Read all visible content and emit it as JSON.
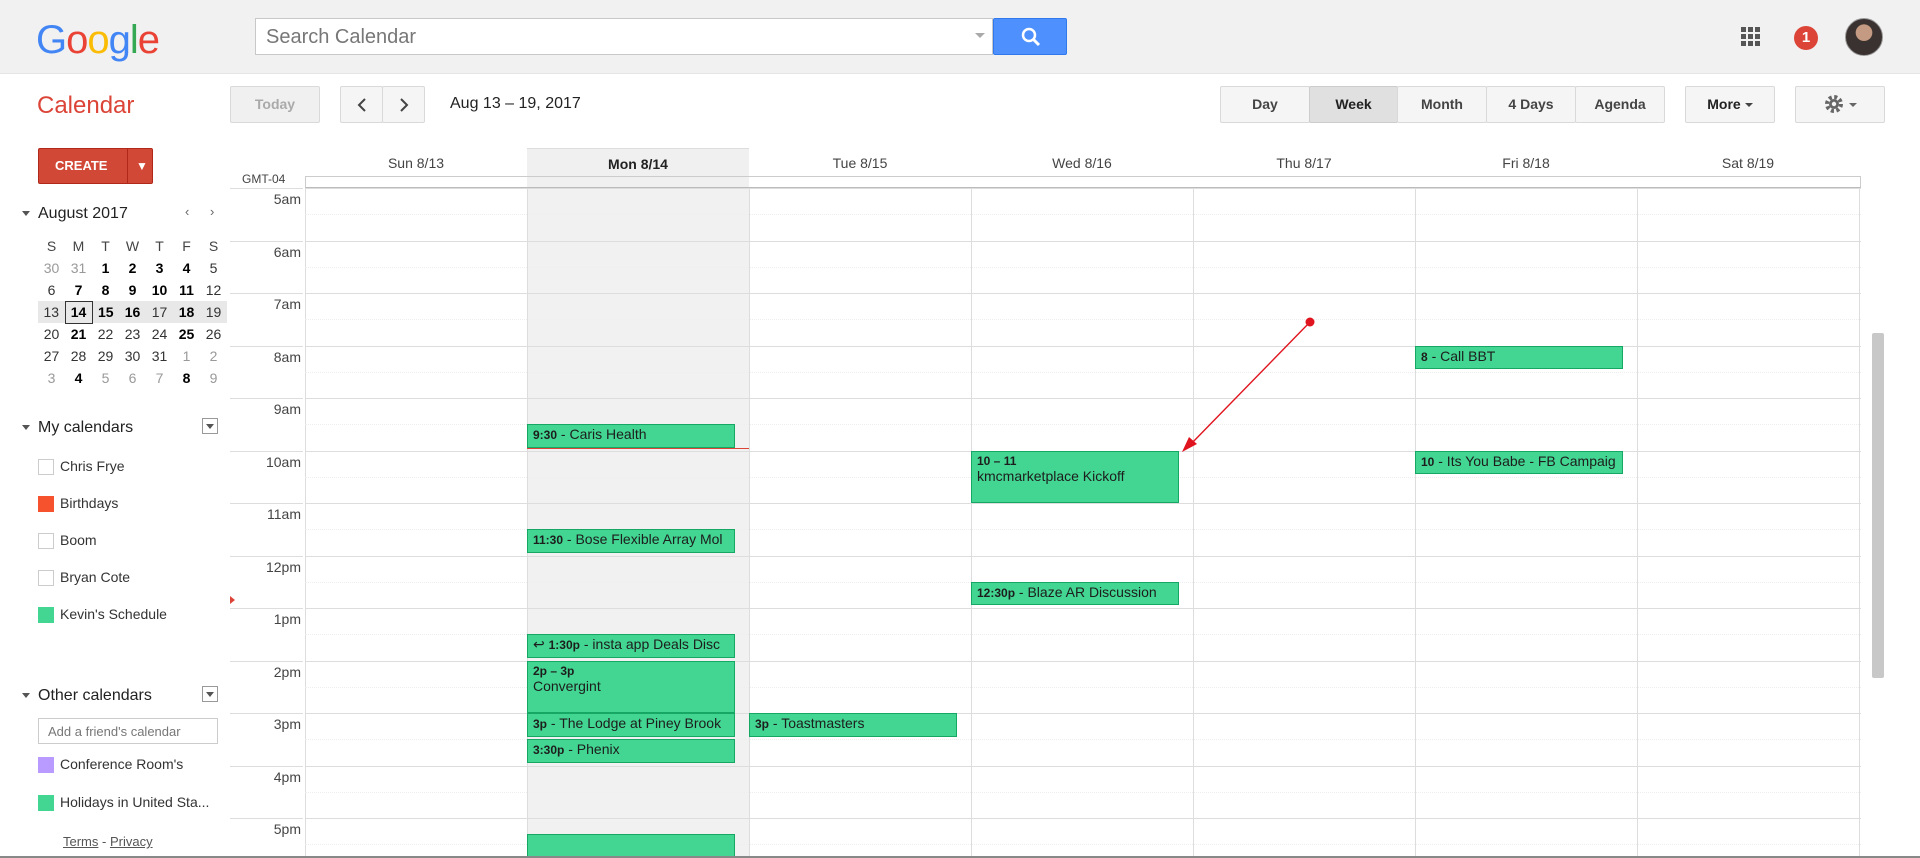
{
  "topbar": {
    "logo": [
      "G",
      "o",
      "o",
      "g",
      "l",
      "e"
    ],
    "search_placeholder": "Search Calendar",
    "notifications": "1"
  },
  "header": {
    "title": "Calendar",
    "today": "Today",
    "date_range": "Aug 13 – 19, 2017",
    "views": {
      "day": "Day",
      "week": "Week",
      "month": "Month",
      "four_days": "4 Days",
      "agenda": "Agenda"
    },
    "more": "More"
  },
  "sidebar": {
    "create": "CREATE",
    "mini_month": "August 2017",
    "weekdays": [
      "S",
      "M",
      "T",
      "W",
      "T",
      "F",
      "S"
    ],
    "weeks": [
      [
        {
          "d": "30",
          "c": "om"
        },
        {
          "d": "31",
          "c": "om"
        },
        {
          "d": "1",
          "c": "b"
        },
        {
          "d": "2",
          "c": "b"
        },
        {
          "d": "3",
          "c": "b"
        },
        {
          "d": "4",
          "c": "b"
        },
        {
          "d": "5",
          "c": ""
        }
      ],
      [
        {
          "d": "6",
          "c": ""
        },
        {
          "d": "7",
          "c": "b"
        },
        {
          "d": "8",
          "c": "b"
        },
        {
          "d": "9",
          "c": "b"
        },
        {
          "d": "10",
          "c": "b"
        },
        {
          "d": "11",
          "c": "b"
        },
        {
          "d": "12",
          "c": ""
        }
      ],
      [
        {
          "d": "13",
          "c": ""
        },
        {
          "d": "14",
          "c": "b today"
        },
        {
          "d": "15",
          "c": "b"
        },
        {
          "d": "16",
          "c": "b"
        },
        {
          "d": "17",
          "c": ""
        },
        {
          "d": "18",
          "c": "b"
        },
        {
          "d": "19",
          "c": ""
        }
      ],
      [
        {
          "d": "20",
          "c": ""
        },
        {
          "d": "21",
          "c": "b"
        },
        {
          "d": "22",
          "c": ""
        },
        {
          "d": "23",
          "c": ""
        },
        {
          "d": "24",
          "c": ""
        },
        {
          "d": "25",
          "c": "b"
        },
        {
          "d": "26",
          "c": ""
        }
      ],
      [
        {
          "d": "27",
          "c": ""
        },
        {
          "d": "28",
          "c": ""
        },
        {
          "d": "29",
          "c": ""
        },
        {
          "d": "30",
          "c": ""
        },
        {
          "d": "31",
          "c": ""
        },
        {
          "d": "1",
          "c": "om"
        },
        {
          "d": "2",
          "c": "om"
        }
      ],
      [
        {
          "d": "3",
          "c": "om"
        },
        {
          "d": "4",
          "c": "om b"
        },
        {
          "d": "5",
          "c": "om"
        },
        {
          "d": "6",
          "c": "om"
        },
        {
          "d": "7",
          "c": "om"
        },
        {
          "d": "8",
          "c": "om b"
        },
        {
          "d": "9",
          "c": "om"
        }
      ]
    ],
    "my_calendars": "My calendars",
    "my_items": [
      {
        "label": "Chris Frye",
        "color": "#ffffff"
      },
      {
        "label": "Birthdays",
        "color": "#f6522e"
      },
      {
        "label": "Boom",
        "color": "#ffffff"
      },
      {
        "label": "Bryan Cote",
        "color": "#ffffff"
      },
      {
        "label": "Kevin's Schedule",
        "color": "#42d692"
      }
    ],
    "other_calendars": "Other calendars",
    "friend_placeholder": "Add a friend's calendar",
    "other_items": [
      {
        "label": "Conference Room's",
        "color": "#b99aff"
      },
      {
        "label": "Holidays in United Sta...",
        "color": "#42d692"
      }
    ],
    "terms": "Terms",
    "privacy": "Privacy",
    "sep": " - "
  },
  "grid": {
    "timezone": "GMT-04",
    "days": [
      "Sun 8/13",
      "Mon 8/14",
      "Tue 8/15",
      "Wed 8/16",
      "Thu 8/17",
      "Fri 8/18",
      "Sat 8/19"
    ],
    "hours": [
      "5am",
      "6am",
      "7am",
      "8am",
      "9am",
      "10am",
      "11am",
      "12pm",
      "1pm",
      "2pm",
      "3pm",
      "4pm",
      "5pm"
    ],
    "events": [
      {
        "day": 1,
        "start": 9.5,
        "end": 9.95,
        "time": "9:30",
        "title": " - Caris Health"
      },
      {
        "day": 1,
        "start": 11.5,
        "end": 11.95,
        "time": "11:30",
        "title": " - Bose Flexible Array Mol"
      },
      {
        "day": 1,
        "start": 13.5,
        "end": 13.95,
        "time": "1:30p",
        "title": " - insta app Deals Disc",
        "reply": true
      },
      {
        "day": 1,
        "start": 14.0,
        "end": 15.0,
        "time": "2p – 3p",
        "title": "Convergint",
        "block": true
      },
      {
        "day": 1,
        "start": 15.0,
        "end": 15.45,
        "time": "3p",
        "title": " - The Lodge at Piney Brook"
      },
      {
        "day": 1,
        "start": 15.5,
        "end": 15.95,
        "time": "3:30p",
        "title": " - Phenix"
      },
      {
        "day": 1,
        "start": 17.3,
        "end": 17.8,
        "time": "",
        "title": ""
      },
      {
        "day": 2,
        "start": 15.0,
        "end": 15.45,
        "time": "3p",
        "title": " - Toastmasters"
      },
      {
        "day": 3,
        "start": 10.0,
        "end": 11.0,
        "time": "10 – 11",
        "title": "kmcmarketplace Kickoff",
        "block": true
      },
      {
        "day": 3,
        "start": 12.5,
        "end": 12.95,
        "time": "12:30p",
        "title": " - Blaze AR Discussion"
      },
      {
        "day": 5,
        "start": 8.0,
        "end": 8.45,
        "time": "8",
        "title": " - Call BBT"
      },
      {
        "day": 5,
        "start": 10.0,
        "end": 10.45,
        "time": "10",
        "title": " - Its You Babe - FB Campaig"
      }
    ]
  }
}
